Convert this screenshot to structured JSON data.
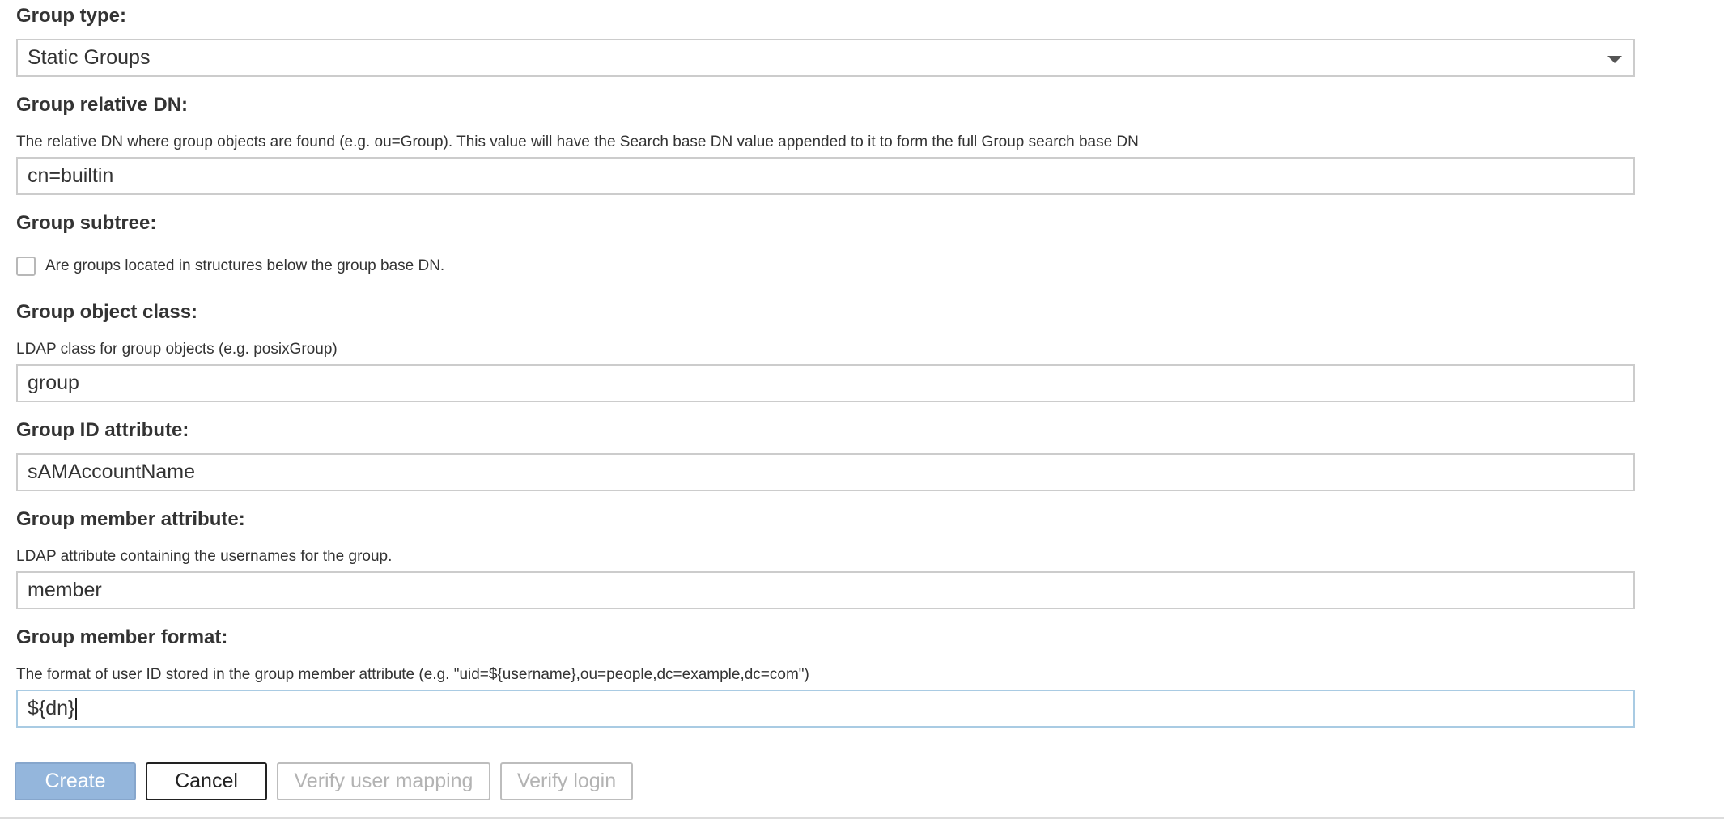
{
  "group_type": {
    "label": "Group type:",
    "selected": "Static Groups"
  },
  "group_relative_dn": {
    "label": "Group relative DN:",
    "help": "The relative DN where group objects are found (e.g. ou=Group). This value will have the Search base DN value appended to it to form the full Group search base DN",
    "value": "cn=builtin"
  },
  "group_subtree": {
    "label": "Group subtree:",
    "checkbox_label": "Are groups located in structures below the group base DN.",
    "checked": false
  },
  "group_object_class": {
    "label": "Group object class:",
    "help": "LDAP class for group objects (e.g. posixGroup)",
    "value": "group"
  },
  "group_id_attribute": {
    "label": "Group ID attribute:",
    "value": "sAMAccountName"
  },
  "group_member_attribute": {
    "label": "Group member attribute:",
    "help": "LDAP attribute containing the usernames for the group.",
    "value": "member"
  },
  "group_member_format": {
    "label": "Group member format:",
    "help": "The format of user ID stored in the group member attribute (e.g. \"uid=${username},ou=people,dc=example,dc=com\")",
    "value": "${dn}"
  },
  "buttons": {
    "create": "Create",
    "cancel": "Cancel",
    "verify_user_mapping": "Verify user mapping",
    "verify_login": "Verify login"
  },
  "colors": {
    "primary_button": "#94b6dc",
    "focus_border": "#a9cbe3",
    "field_border": "#cccccc"
  },
  "icons": {
    "select_arrow": "chevron-down-icon"
  }
}
